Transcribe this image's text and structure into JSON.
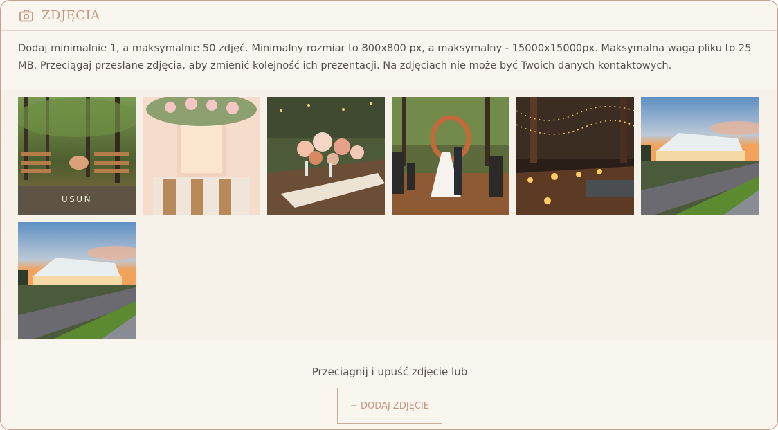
{
  "section": {
    "icon": "camera-icon",
    "title": "ZDJĘCIA",
    "accent_color": "#c4967f"
  },
  "info_text": "Dodaj minimalnie 1, a maksymalnie 50 zdjęć. Minimalny rozmiar to 800x800  px, a maksymalny - 15000x15000px. Maksymalna waga pliku to 25 MB.  Przeciągaj przesłane zdjęcia, aby zmienić kolejność ich prezentacji. Na  zdjęciach nie może być Twoich danych kontaktowych.",
  "photos": [
    {
      "subject": "forest-ceremony-chairs",
      "remove_label": "USUŃ"
    },
    {
      "subject": "floral-drape-reception-table"
    },
    {
      "subject": "floral-centerpiece-table"
    },
    {
      "subject": "forest-ceremony-couple"
    },
    {
      "subject": "candlelit-table-string-lights"
    },
    {
      "subject": "glass-tent-sunset"
    },
    {
      "subject": "glass-tent-sunset"
    }
  ],
  "dropzone": {
    "text": "Przeciągnij i upuść zdjęcie lub",
    "add_button_label": "+ DODAJ ZDJĘCIE"
  }
}
